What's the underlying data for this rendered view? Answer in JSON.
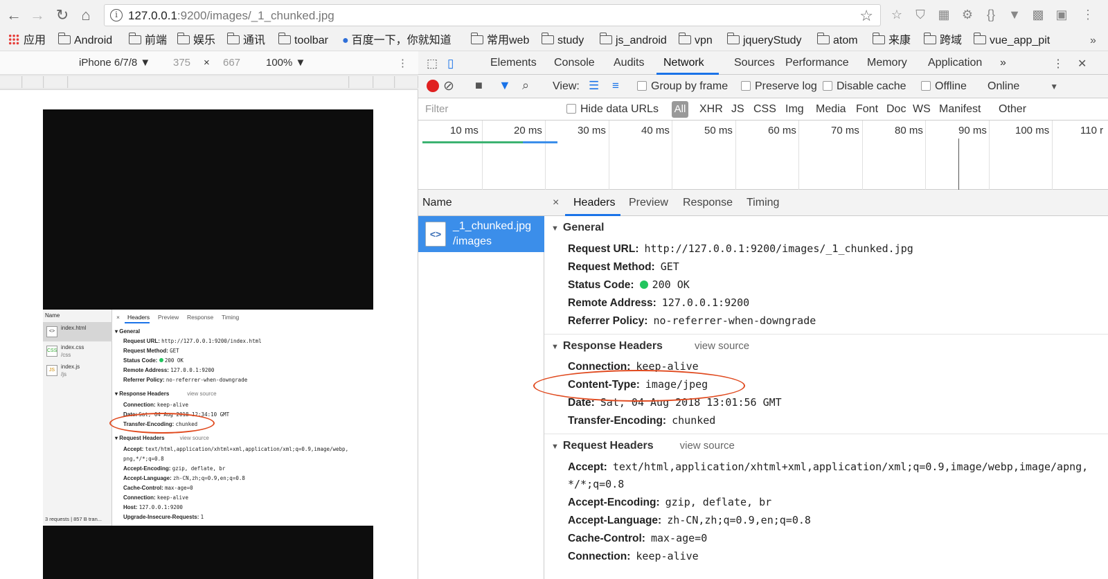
{
  "browser": {
    "url_host": "127.0.0.1",
    "url_rest": ":9200/images/_1_chunked.jpg"
  },
  "bookmarks": [
    "应用",
    "Android",
    "前端",
    "娱乐",
    "通讯",
    "toolbar",
    "百度一下，你就知道",
    "常用web",
    "study",
    "js_android",
    "vpn",
    "jqueryStudy",
    "atom",
    "来康",
    "跨域",
    "vue_app_pit"
  ],
  "device_toolbar": {
    "device": "iPhone 6/7/8 ▼",
    "width": "375",
    "times": "×",
    "height": "667",
    "zoom": "100% ▼"
  },
  "mini_devtools": {
    "name_header": "Name",
    "rows": [
      {
        "icon": "<>",
        "name": "index.html",
        "path": ""
      },
      {
        "icon": "CSS",
        "name": "index.css",
        "path": "/css"
      },
      {
        "icon": "JS",
        "name": "index.js",
        "path": "/js"
      }
    ],
    "footer": "3 requests | 857 B tran...",
    "tabs": [
      "×",
      "Headers",
      "Preview",
      "Response",
      "Timing"
    ],
    "general_title": "General",
    "general": [
      {
        "k": "Request URL:",
        "v": "http://127.0.0.1:9200/index.html"
      },
      {
        "k": "Request Method:",
        "v": "GET"
      },
      {
        "k": "Status Code:",
        "v": "200 OK"
      },
      {
        "k": "Remote Address:",
        "v": "127.0.0.1:9200"
      },
      {
        "k": "Referrer Policy:",
        "v": "no-referrer-when-downgrade"
      }
    ],
    "response_title": "Response Headers",
    "view_source": "view source",
    "response": [
      {
        "k": "Connection:",
        "v": "keep-alive"
      },
      {
        "k": "Date:",
        "v": "Sat, 04 Aug 2018 12:34:10 GMT"
      },
      {
        "k": "Transfer-Encoding:",
        "v": "chunked"
      }
    ],
    "request_title": "Request Headers",
    "request": [
      {
        "k": "Accept:",
        "v": "text/html,application/xhtml+xml,application/xml;q=0.9,image/webp,"
      },
      {
        "k": "",
        "v": "png,*/*;q=0.8"
      },
      {
        "k": "Accept-Encoding:",
        "v": "gzip, deflate, br"
      },
      {
        "k": "Accept-Language:",
        "v": "zh-CN,zh;q=0.9,en;q=0.8"
      },
      {
        "k": "Cache-Control:",
        "v": "max-age=0"
      },
      {
        "k": "Connection:",
        "v": "keep-alive"
      },
      {
        "k": "Host:",
        "v": "127.0.0.1:9200"
      },
      {
        "k": "Upgrade-Insecure-Requests:",
        "v": "1"
      }
    ]
  },
  "devtools": {
    "tabs": [
      "Elements",
      "Console",
      "Audits",
      "Network",
      "Sources",
      "Performance",
      "Memory",
      "Application",
      "»"
    ],
    "active_tab": "Network",
    "network_toolbar": {
      "view": "View:",
      "group_by_frame": "Group by frame",
      "preserve_log": "Preserve log",
      "disable_cache": "Disable cache",
      "offline": "Offline",
      "online": "Online"
    },
    "filter": {
      "placeholder": "Filter",
      "hide_data_urls": "Hide data URLs",
      "types": [
        "All",
        "XHR",
        "JS",
        "CSS",
        "Img",
        "Media",
        "Font",
        "Doc",
        "WS",
        "Manifest",
        "Other"
      ]
    },
    "timeline_ticks": [
      "10 ms",
      "20 ms",
      "30 ms",
      "40 ms",
      "50 ms",
      "60 ms",
      "70 ms",
      "80 ms",
      "90 ms",
      "100 ms",
      "110 r"
    ],
    "name_header": "Name",
    "selected_request": {
      "name": "_1_chunked.jpg",
      "path": "/images"
    },
    "detail_tabs": [
      "×",
      "Headers",
      "Preview",
      "Response",
      "Timing"
    ],
    "general_title": "General",
    "general": [
      {
        "k": "Request URL:",
        "v": "http://127.0.0.1:9200/images/_1_chunked.jpg"
      },
      {
        "k": "Request Method:",
        "v": "GET"
      },
      {
        "k": "Status Code:",
        "v": "200 OK"
      },
      {
        "k": "Remote Address:",
        "v": "127.0.0.1:9200"
      },
      {
        "k": "Referrer Policy:",
        "v": "no-referrer-when-downgrade"
      }
    ],
    "response_title": "Response Headers",
    "view_source": "view source",
    "response": [
      {
        "k": "Connection:",
        "v": "keep-alive"
      },
      {
        "k": "Content-Type:",
        "v": "image/jpeg"
      },
      {
        "k": "Date:",
        "v": "Sat, 04 Aug 2018 13:01:56 GMT"
      },
      {
        "k": "Transfer-Encoding:",
        "v": "chunked"
      }
    ],
    "request_title": "Request Headers",
    "request": [
      {
        "k": "Accept:",
        "v": "text/html,application/xhtml+xml,application/xml;q=0.9,image/webp,image/apng,"
      },
      {
        "k": "",
        "v": "*/*;q=0.8"
      },
      {
        "k": "Accept-Encoding:",
        "v": "gzip, deflate, br"
      },
      {
        "k": "Accept-Language:",
        "v": "zh-CN,zh;q=0.9,en;q=0.8"
      },
      {
        "k": "Cache-Control:",
        "v": "max-age=0"
      },
      {
        "k": "Connection:",
        "v": "keep-alive"
      }
    ]
  },
  "colors": {
    "accent": "#1a73e8",
    "selected_row": "#3b8eea",
    "annotation": "#e04a1f",
    "record": "#e02020",
    "status_ok": "#22c55e"
  }
}
